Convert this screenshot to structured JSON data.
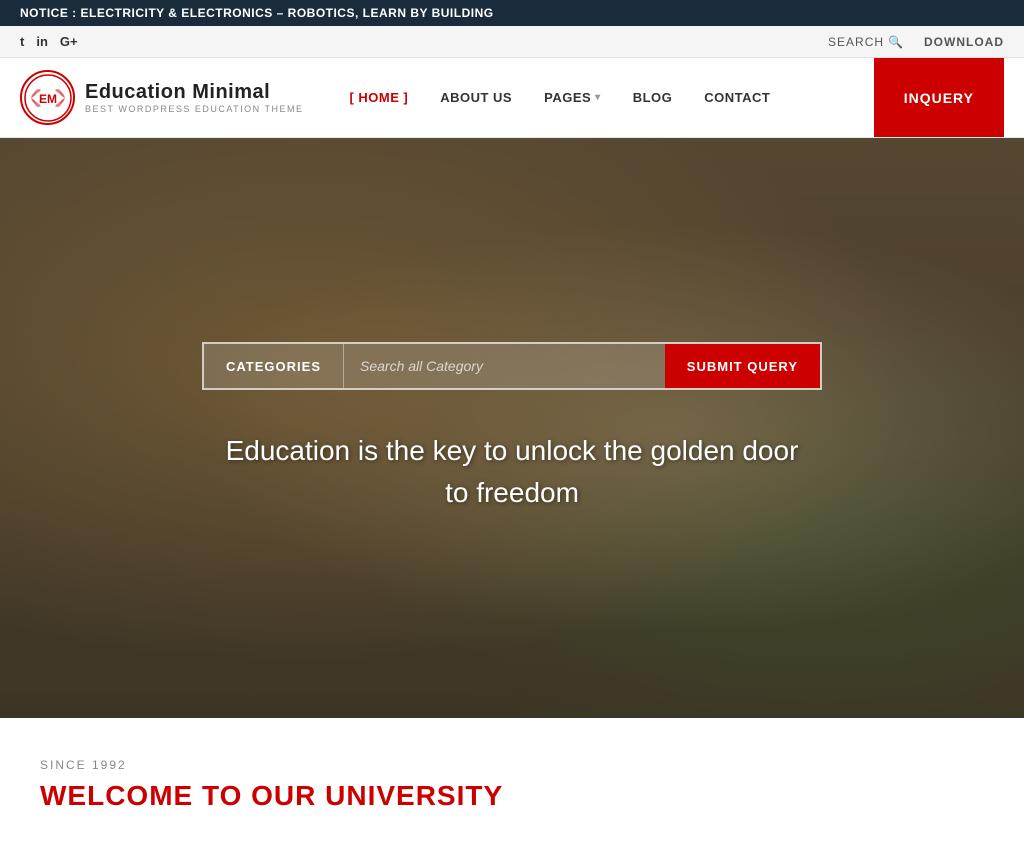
{
  "notice": {
    "prefix": "NOTICE :",
    "text": "ELECTRICITY & ELECTRONICS – ROBOTICS, LEARN BY BUILDING"
  },
  "topbar": {
    "social": [
      {
        "name": "twitter",
        "label": "t"
      },
      {
        "name": "linkedin",
        "label": "in"
      },
      {
        "name": "google-plus",
        "label": "G+"
      }
    ],
    "search_label": "SEARCH",
    "download_label": "DOWNLOAD"
  },
  "nav": {
    "logo_initials": "EM",
    "logo_title": "Education Minimal",
    "logo_subtitle": "BEST WORDPRESS EDUCATION THEME",
    "items": [
      {
        "id": "home",
        "label": "HOME",
        "bracket": true,
        "active": true
      },
      {
        "id": "about",
        "label": "ABOUT US",
        "active": false
      },
      {
        "id": "pages",
        "label": "PAGES",
        "has_dropdown": true,
        "active": false
      },
      {
        "id": "blog",
        "label": "BLOG",
        "active": false
      },
      {
        "id": "contact",
        "label": "CONTACT",
        "active": false
      }
    ],
    "inquiry_label": "INQUERY"
  },
  "hero": {
    "categories_label": "CATEGORIES",
    "search_placeholder": "Search all Category",
    "submit_label": "SUBMIT QUERY",
    "tagline": "Education is the key to unlock the golden door to freedom"
  },
  "below_hero": {
    "since_label": "SINCE 1992",
    "welcome_heading": "WELCOME TO OUR UNIVERSITY"
  }
}
